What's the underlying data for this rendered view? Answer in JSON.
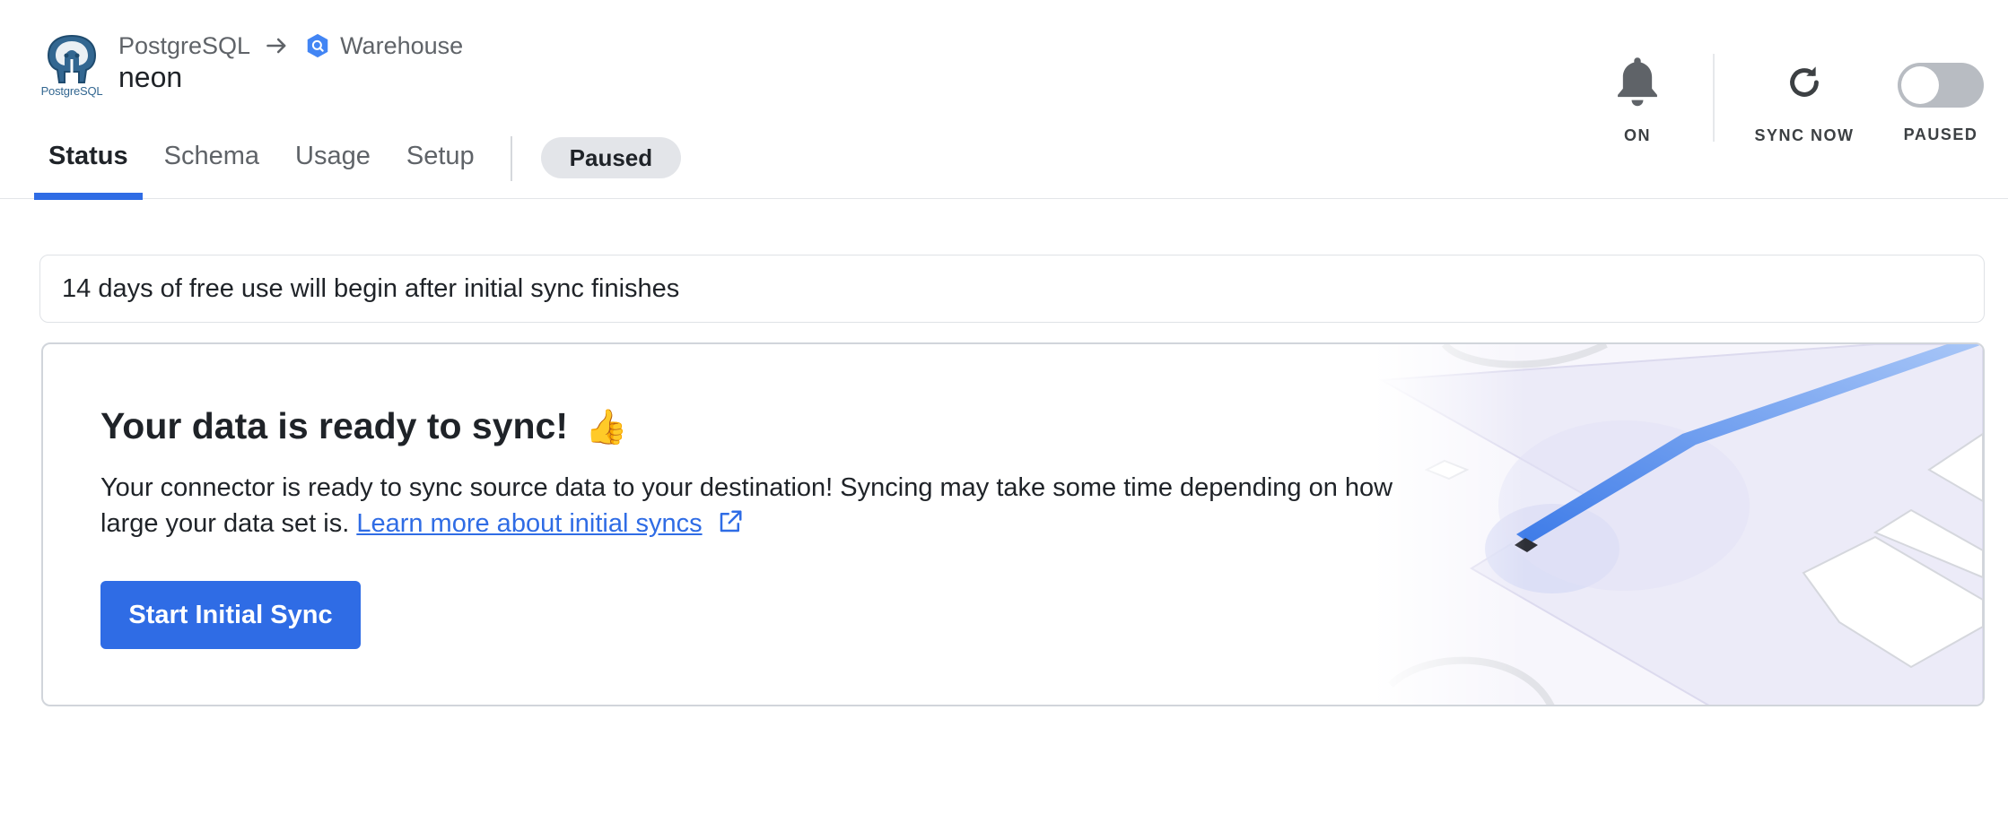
{
  "header": {
    "source_logo_text": "PostgreSQL",
    "source_name": "PostgreSQL",
    "destination_name": "Warehouse",
    "connector_name": "neon",
    "tabs": [
      {
        "label": "Status",
        "active": true
      },
      {
        "label": "Schema",
        "active": false
      },
      {
        "label": "Usage",
        "active": false
      },
      {
        "label": "Setup",
        "active": false
      }
    ],
    "status_badge": "Paused",
    "actions": {
      "notifications_label": "ON",
      "sync_now_label": "SYNC NOW",
      "pause_toggle_label": "PAUSED"
    }
  },
  "notice": {
    "text": "14 days of free use will begin after initial sync finishes"
  },
  "card": {
    "title": "Your data is ready to sync!",
    "title_emoji": "👍",
    "description": "Your connector is ready to sync source data to your destination! Syncing may take some time depending on how large your data set is.",
    "link_text": "Learn more about initial syncs",
    "button_label": "Start Initial Sync"
  },
  "icons": {
    "source": "postgresql-elephant-icon",
    "arrow": "arrow-right-icon",
    "destination": "bigquery-hexagon-icon",
    "notifications": "bell-icon",
    "sync": "refresh-icon",
    "external": "external-link-icon"
  },
  "colors": {
    "accent": "#2f6ce5",
    "postgres_blue": "#336791",
    "badge_bg": "#e3e5e9",
    "toggle_off": "#b8bcc2"
  }
}
